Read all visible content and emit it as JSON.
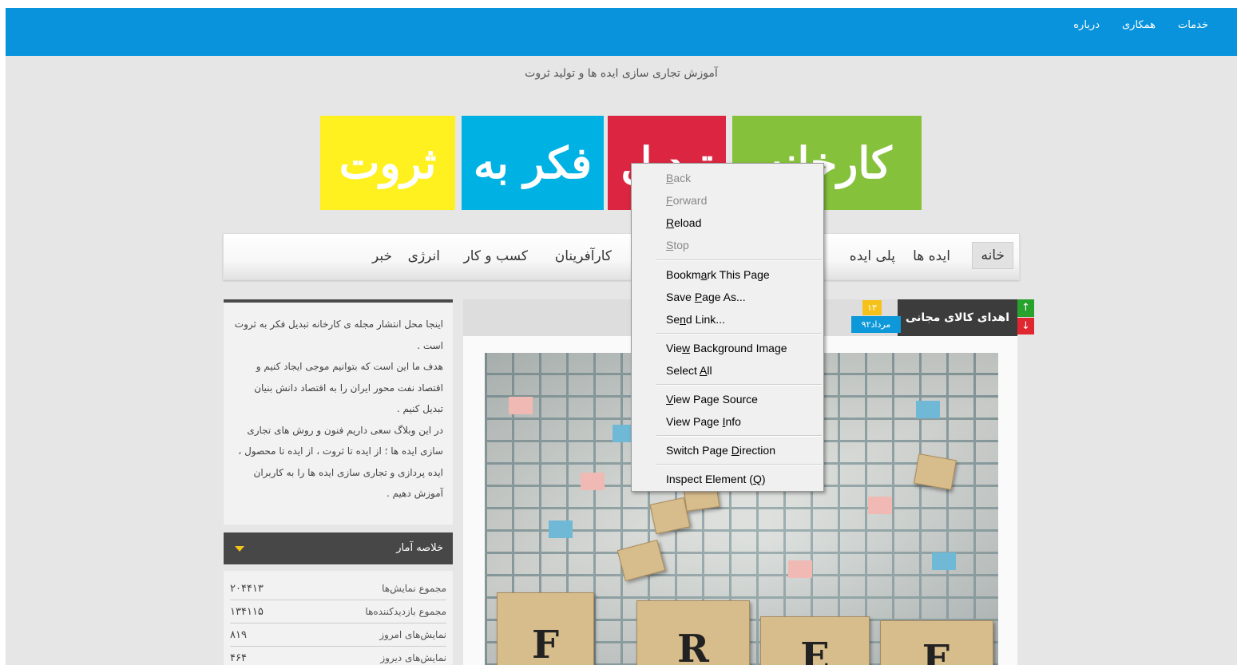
{
  "topbar": {
    "links": [
      "درباره",
      "همکاری",
      "خدمات"
    ]
  },
  "tagline": "آموزش تجاری سازی ایده ها و تولید ثروت",
  "logo": {
    "word_green": "کارخانه",
    "word_red": "تبدیل",
    "word_blue": "فکر به",
    "word_yellow": "ثروت",
    "colors": {
      "green": "#86c13c",
      "red": "#dc2540",
      "blue": "#00b2e3",
      "yellow": "#fff01f"
    }
  },
  "nav": {
    "items": [
      "خانه",
      "ایده ها",
      "پلی ایده",
      "کارآفرینان",
      "کسب و کار",
      "انرژی",
      "خبر"
    ]
  },
  "sidebar": {
    "about": [
      "اینجا محل انتشار مجله ی کارخانه تبدیل فکر به ثروت است .",
      "هدف ما این است که بتوانیم موجی ایجاد کنیم و اقتصاد نفت محور ایران را به اقتصاد دانش بنیان تبدیل کنیم .",
      "در این وبلاگ سعی داریم فنون و روش های تجاری سازی ایده ها ؛ از ایده تا ثروت ، از ایده تا محصول ، ایده پردازی و تجاری سازی ایده ها را به کاربران آموزش دهیم ."
    ],
    "stats_title": "خلاصه آمار",
    "stats": [
      {
        "label": "مجموع نمایش‌ها",
        "value": "۲۰۴۴۱۳"
      },
      {
        "label": "مجموع بازدیدکننده‌ها",
        "value": "۱۳۴۱۱۵"
      },
      {
        "label": "نمایش‌های امروز",
        "value": "۸۱۹"
      },
      {
        "label": "نمایش‌های دیروز",
        "value": "۴۶۴"
      }
    ]
  },
  "post": {
    "title": "اهدای کالای مجانی",
    "day": "۱۳",
    "month": "مرداد۹۲",
    "vote_up": "↑",
    "vote_down": "↓",
    "photo_tiles": [
      "F",
      "R",
      "E",
      "E"
    ]
  },
  "context_menu": {
    "items": [
      {
        "pre": "",
        "acc": "B",
        "post": "ack",
        "disabled": true
      },
      {
        "pre": "",
        "acc": "F",
        "post": "orward",
        "disabled": true
      },
      {
        "pre": "",
        "acc": "R",
        "post": "eload",
        "disabled": false
      },
      {
        "pre": "",
        "acc": "S",
        "post": "top",
        "disabled": true
      },
      {
        "pre": "Bookm",
        "acc": "a",
        "post": "rk This Page",
        "disabled": false
      },
      {
        "pre": "Save ",
        "acc": "P",
        "post": "age As...",
        "disabled": false
      },
      {
        "pre": "Se",
        "acc": "n",
        "post": "d Link...",
        "disabled": false
      },
      {
        "pre": "Vie",
        "acc": "w",
        "post": " Background Image",
        "disabled": false
      },
      {
        "pre": "Select ",
        "acc": "A",
        "post": "ll",
        "disabled": false
      },
      {
        "pre": "",
        "acc": "V",
        "post": "iew Page Source",
        "disabled": false
      },
      {
        "pre": "View Page ",
        "acc": "I",
        "post": "nfo",
        "disabled": false
      },
      {
        "pre": "Switch Page ",
        "acc": "D",
        "post": "irection",
        "disabled": false
      },
      {
        "pre": "Inspect Element (",
        "acc": "Q",
        "post": ")",
        "disabled": false
      }
    ]
  }
}
